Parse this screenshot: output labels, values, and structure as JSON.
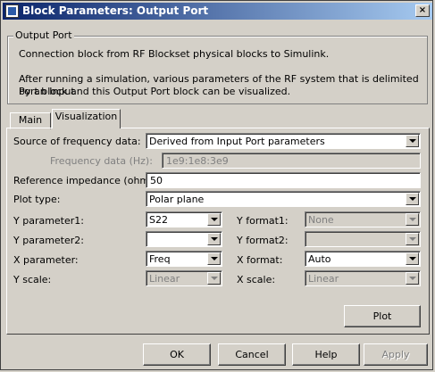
{
  "window": {
    "title": "Block Parameters: Output Port",
    "icon": "simulink-block-icon",
    "close": "×"
  },
  "group": {
    "title": "Output Port",
    "line1": "Connection block from RF Blockset physical blocks to Simulink.",
    "line2a": "After running a simulation, various parameters of the RF system that is delimited by an Input",
    "line2b": "Port block and this Output Port block can be visualized."
  },
  "tabs": [
    {
      "label": "Main"
    },
    {
      "label": "Visualization"
    }
  ],
  "form": {
    "source_label": "Source of frequency data:",
    "source_value": "Derived from Input Port parameters",
    "freq_label": "Frequency data (Hz):",
    "freq_value": "1e9:1e8:3e9",
    "impedance_label": "Reference impedance (ohms):",
    "impedance_value": "50",
    "plot_type_label": "Plot type:",
    "plot_type_value": "Polar plane",
    "y_param1_label": "Y parameter1:",
    "y_param1_value": "S22",
    "y_format1_label": "Y format1:",
    "y_format1_value": "None",
    "y_param2_label": "Y parameter2:",
    "y_param2_value": "",
    "y_format2_label": "Y format2:",
    "y_format2_value": "",
    "x_param_label": "X parameter:",
    "x_param_value": "Freq",
    "x_format_label": "X format:",
    "x_format_value": "Auto",
    "y_scale_label": "Y scale:",
    "y_scale_value": "Linear",
    "x_scale_label": "X scale:",
    "x_scale_value": "Linear"
  },
  "buttons": {
    "plot": "Plot",
    "ok": "OK",
    "cancel": "Cancel",
    "help": "Help",
    "apply": "Apply"
  }
}
